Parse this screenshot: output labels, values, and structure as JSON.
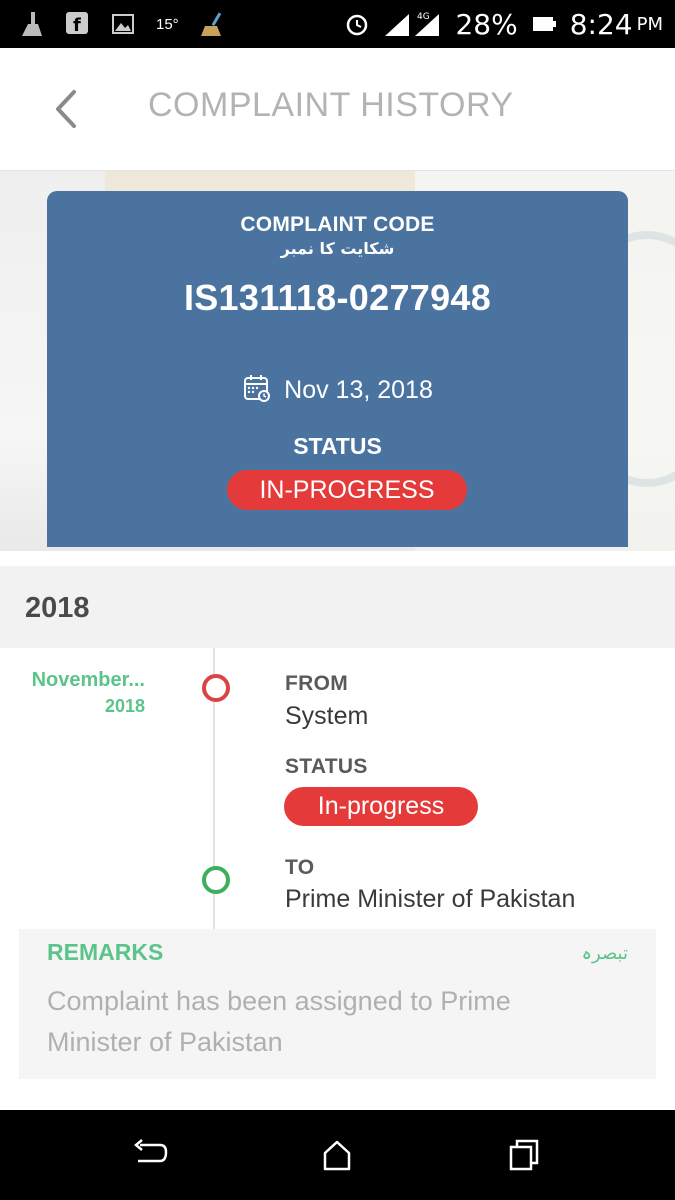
{
  "status_bar": {
    "temperature": "15°",
    "network": "4G",
    "battery": "28%",
    "time": "8:24",
    "ampm": "PM"
  },
  "header": {
    "title": "COMPLAINT HISTORY"
  },
  "card": {
    "code_label": "COMPLAINT CODE",
    "code_label_urdu": "شکایت کا نمبر",
    "code": "IS131118-0277948",
    "date": "Nov 13, 2018",
    "status_label": "STATUS",
    "status": "IN-PROGRESS"
  },
  "timeline": {
    "year": "2018",
    "entry": {
      "month": "November...",
      "year": "2018",
      "from_label": "FROM",
      "from_value": "System",
      "status_label": "STATUS",
      "status_value": "In-progress",
      "to_label": "TO",
      "to_value": "Prime Minister of Pakistan"
    }
  },
  "remarks": {
    "label": "REMARKS",
    "label_urdu": "تبصرہ",
    "text": "Complaint has been assigned to Prime Minister of Pakistan"
  },
  "colors": {
    "card_blue": "#4b73a0",
    "badge_red": "#e53a3a",
    "accent_green": "#5cc48a"
  },
  "icons": [
    "broom-icon",
    "facebook-icon",
    "image-icon",
    "alarm-icon",
    "signal-icon",
    "battery-icon",
    "back-arrow-icon",
    "calendar-icon",
    "nav-back-icon",
    "nav-home-icon",
    "nav-recent-icon"
  ]
}
